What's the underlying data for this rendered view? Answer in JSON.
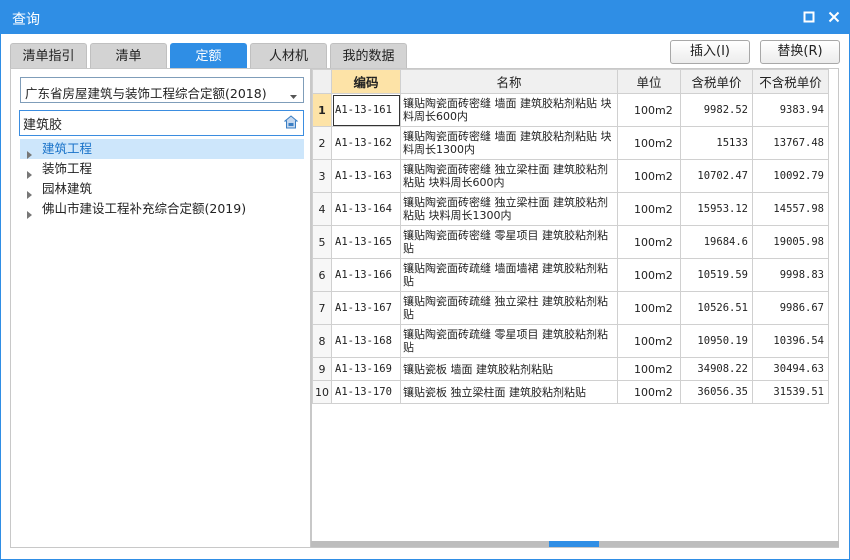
{
  "window": {
    "title": "查询"
  },
  "tabs": [
    {
      "label": "清单指引",
      "active": false
    },
    {
      "label": "清单",
      "active": false
    },
    {
      "label": "定额",
      "active": true
    },
    {
      "label": "人材机",
      "active": false
    },
    {
      "label": "我的数据",
      "active": false
    }
  ],
  "buttons": {
    "insert": "插入(I)",
    "replace": "替换(R)"
  },
  "quota_select": {
    "value": "广东省房屋建筑与装饰工程综合定额(2018)"
  },
  "search": {
    "value": "建筑胶",
    "placeholder": ""
  },
  "tree": [
    {
      "label": "建筑工程",
      "selected": true
    },
    {
      "label": "装饰工程",
      "selected": false
    },
    {
      "label": "园林建筑",
      "selected": false
    },
    {
      "label": "佛山市建设工程补充综合定额(2019)",
      "selected": false
    }
  ],
  "grid": {
    "columns": {
      "rownum": "",
      "code": "编码",
      "name": "名称",
      "unit": "单位",
      "price_tax": "含税单价",
      "price_notax": "不含税单价"
    },
    "rows": [
      {
        "n": "1",
        "code": "A1-13-161",
        "name": "镶贴陶瓷面砖密缝 墙面 建筑胶粘剂粘贴 块料周长600内",
        "unit": "100m2",
        "price_tax": "9982.52",
        "price_notax": "9383.94"
      },
      {
        "n": "2",
        "code": "A1-13-162",
        "name": "镶贴陶瓷面砖密缝 墙面 建筑胶粘剂粘贴 块料周长1300内",
        "unit": "100m2",
        "price_tax": "15133",
        "price_notax": "13767.48"
      },
      {
        "n": "3",
        "code": "A1-13-163",
        "name": "镶贴陶瓷面砖密缝 独立梁柱面 建筑胶粘剂粘贴 块料周长600内",
        "unit": "100m2",
        "price_tax": "10702.47",
        "price_notax": "10092.79"
      },
      {
        "n": "4",
        "code": "A1-13-164",
        "name": "镶贴陶瓷面砖密缝 独立梁柱面 建筑胶粘剂粘贴 块料周长1300内",
        "unit": "100m2",
        "price_tax": "15953.12",
        "price_notax": "14557.98"
      },
      {
        "n": "5",
        "code": "A1-13-165",
        "name": "镶贴陶瓷面砖密缝 零星项目 建筑胶粘剂粘贴",
        "unit": "100m2",
        "price_tax": "19684.6",
        "price_notax": "19005.98"
      },
      {
        "n": "6",
        "code": "A1-13-166",
        "name": "镶贴陶瓷面砖疏缝 墙面墙裙 建筑胶粘剂粘贴",
        "unit": "100m2",
        "price_tax": "10519.59",
        "price_notax": "9998.83"
      },
      {
        "n": "7",
        "code": "A1-13-167",
        "name": "镶贴陶瓷面砖疏缝 独立梁柱 建筑胶粘剂粘贴",
        "unit": "100m2",
        "price_tax": "10526.51",
        "price_notax": "9986.67"
      },
      {
        "n": "8",
        "code": "A1-13-168",
        "name": "镶贴陶瓷面砖疏缝 零星项目 建筑胶粘剂粘贴",
        "unit": "100m2",
        "price_tax": "10950.19",
        "price_notax": "10396.54"
      },
      {
        "n": "9",
        "code": "A1-13-169",
        "name": "镶贴瓷板 墙面 建筑胶粘剂粘贴",
        "unit": "100m2",
        "price_tax": "34908.22",
        "price_notax": "30494.63"
      },
      {
        "n": "10",
        "code": "A1-13-170",
        "name": "镶贴瓷板 独立梁柱面 建筑胶粘剂粘贴",
        "unit": "100m2",
        "price_tax": "36056.35",
        "price_notax": "31539.51"
      }
    ]
  },
  "icons": {
    "maximize": "maximize-icon",
    "close": "close-icon",
    "dropdown": "chevron-down-icon",
    "search": "home-search-icon",
    "tree": "caret-right-icon"
  },
  "colors": {
    "accent": "#2f8ee5",
    "selected_bg": "#cde6fb",
    "header_highlight": "#fde3a7"
  }
}
